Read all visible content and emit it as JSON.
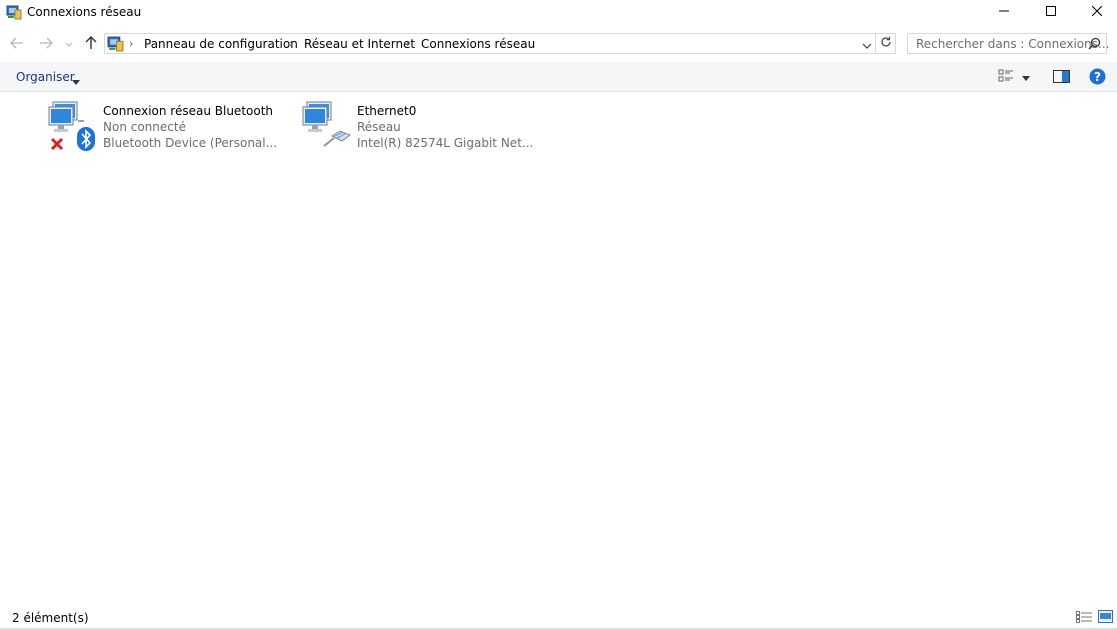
{
  "window": {
    "title": "Connexions réseau",
    "minimize_icon": "minimize-icon",
    "maximize_icon": "maximize-icon",
    "close_icon": "close-icon"
  },
  "nav": {
    "back_icon": "arrow-left-icon",
    "forward_icon": "arrow-right-icon",
    "recent_icon": "chevron-down-icon",
    "up_icon": "arrow-up-icon"
  },
  "address": {
    "breadcrumbs": [
      "Panneau de configuration",
      "Réseau et Internet",
      "Connexions réseau"
    ],
    "separator": "›",
    "location_icon": "control-panel-icon",
    "dropdown_icon": "chevron-down-icon",
    "refresh_icon": "refresh-icon"
  },
  "search": {
    "placeholder": "Rechercher dans : Connexions...",
    "icon": "search-icon"
  },
  "toolbar": {
    "organise_label": "Organiser",
    "view_options_icon": "view-options-icon",
    "preview_pane_icon": "preview-pane-icon",
    "help_icon": "help-icon"
  },
  "items": [
    {
      "name": "Connexion réseau Bluetooth",
      "status": "Non connecté",
      "device": "Bluetooth Device (Personal...",
      "icon": "network-computer-icon",
      "badge_icons": [
        "disconnected-x-icon",
        "bluetooth-icon"
      ]
    },
    {
      "name": "Ethernet0",
      "status": "Réseau",
      "device": "Intel(R) 82574L Gigabit Net...",
      "icon": "network-computer-icon",
      "badge_icons": [
        "ethernet-cable-icon"
      ]
    }
  ],
  "status_bar": {
    "count_text": "2 élément(s)",
    "details_view_icon": "details-view-icon",
    "large_icons_view_icon": "large-icons-view-icon"
  },
  "colors": {
    "accent": "#1e3287",
    "help": "#1e6fd9",
    "bluetooth": "#1d74d6",
    "error": "#e02020"
  }
}
